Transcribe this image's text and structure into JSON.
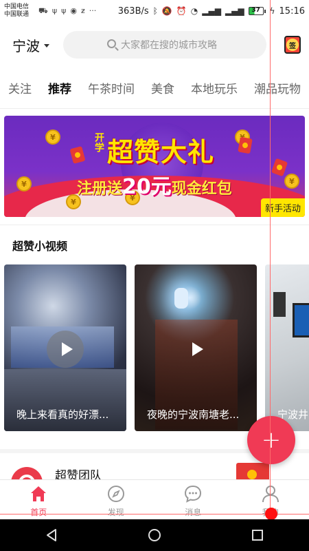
{
  "status_bar": {
    "carrier_1": "中国电信",
    "carrier_2": "中国联通",
    "network_speed": "363B/s",
    "battery": "37",
    "time": "15:16"
  },
  "header": {
    "city": "宁波",
    "search_placeholder": "大家都在搜的城市攻略",
    "sign_label": "签"
  },
  "tabs": [
    {
      "label": "关注"
    },
    {
      "label": "推荐",
      "active": true
    },
    {
      "label": "午茶时间"
    },
    {
      "label": "美食"
    },
    {
      "label": "本地玩乐"
    },
    {
      "label": "潮品玩物"
    }
  ],
  "banner": {
    "line_kai": "开学",
    "title": "超赞大礼",
    "subtitle_prefix": "注册送",
    "subtitle_amount": "20元",
    "subtitle_suffix": "现金红包",
    "badge": "新手活动"
  },
  "section": {
    "title": "超赞小视频"
  },
  "videos": [
    {
      "caption": "晚上来看真的好漂..."
    },
    {
      "caption": "夜晚的宁波南塘老..."
    },
    {
      "caption": "宁波井"
    }
  ],
  "team": {
    "name": "超赞团队"
  },
  "bottom_nav": [
    {
      "label": "首页",
      "active": true
    },
    {
      "label": "发现"
    },
    {
      "label": "消息"
    },
    {
      "label": "我的"
    }
  ],
  "colors": {
    "accent": "#f03a55"
  }
}
